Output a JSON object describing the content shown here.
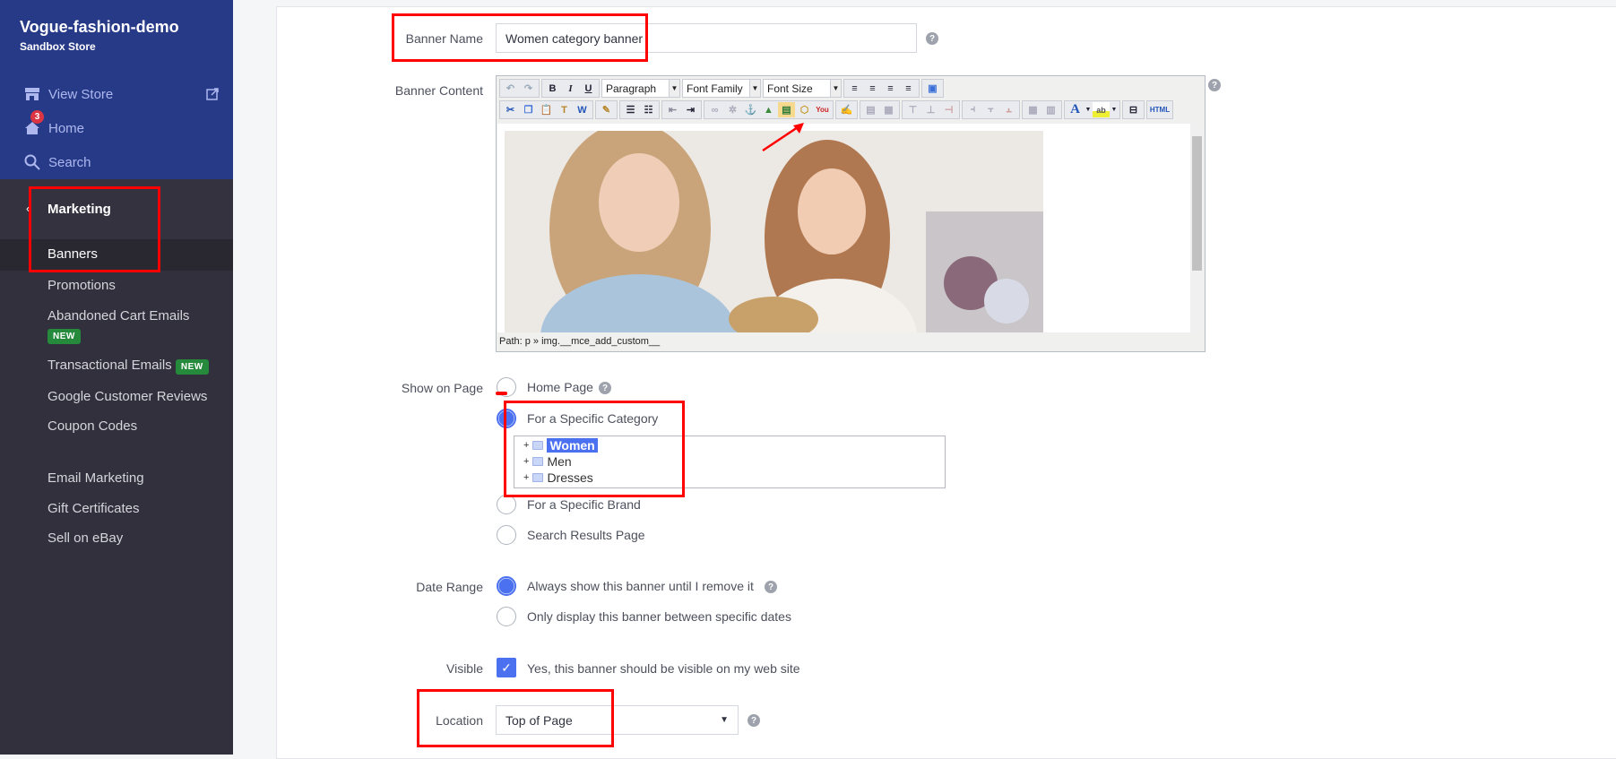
{
  "sidebar": {
    "store_name": "Vogue-fashion-demo",
    "store_sub": "Sandbox Store",
    "view_store": "View Store",
    "home": "Home",
    "home_badge": "3",
    "search": "Search",
    "section": "Marketing",
    "items": [
      {
        "label": "Banners"
      },
      {
        "label": "Promotions"
      },
      {
        "label": "Abandoned Cart Emails",
        "badge": "NEW"
      },
      {
        "label": "Transactional Emails",
        "badge": "NEW"
      },
      {
        "label": "Google Customer Reviews"
      },
      {
        "label": "Coupon Codes"
      },
      {
        "label": "Email Marketing"
      },
      {
        "label": "Gift Certificates"
      },
      {
        "label": "Sell on eBay"
      }
    ]
  },
  "form": {
    "banner_name_label": "Banner Name",
    "banner_name_value": "Women category banner",
    "banner_content_label": "Banner Content",
    "editor": {
      "format": "Paragraph",
      "font_family": "Font Family",
      "font_size": "Font Size",
      "path": "Path: p » img.__mce_add_custom__",
      "html_btn": "HTML"
    },
    "show_on_page_label": "Show on Page",
    "show_options": [
      "Home Page",
      "For a Specific Category",
      "For a Specific Brand",
      "Search Results Page"
    ],
    "show_selected": "For a Specific Category",
    "categories": [
      {
        "name": "Women",
        "selected": true
      },
      {
        "name": "Men"
      },
      {
        "name": "Dresses"
      }
    ],
    "date_range_label": "Date Range",
    "date_options": [
      "Always show this banner until I remove it",
      "Only display this banner between specific dates"
    ],
    "visible_label": "Visible",
    "visible_text": "Yes, this banner should be visible on my web site",
    "visible_checked": true,
    "location_label": "Location",
    "location_value": "Top of Page"
  },
  "colors": {
    "sidebar_top": "#273a87",
    "sidebar": "#31303c",
    "accent": "#4b71f0",
    "new_badge": "#258a3c",
    "annotation": "#ff0000"
  }
}
